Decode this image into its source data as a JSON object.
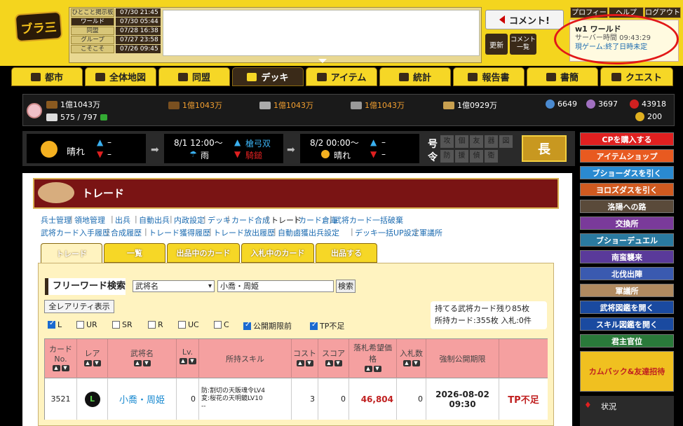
{
  "header": {
    "logo_text": "ブラ三",
    "bbs": {
      "rows": [
        {
          "tab": "ひとこと掲示板",
          "time": "07/30 21:45"
        },
        {
          "tab": "ワールド",
          "time": "07/30 05:44"
        },
        {
          "tab": "同盟",
          "time": "07/28 16:38"
        },
        {
          "tab": "グループ",
          "time": "07/27 23:58"
        },
        {
          "tab": "こそこそ",
          "time": "07/26 09:45"
        }
      ]
    },
    "comment_button": "コメント!",
    "update_button": "更新",
    "list_button": "コメント一覧",
    "links": [
      "プロフィール",
      "ヘルプ",
      "ログアウト"
    ],
    "server": {
      "name": "w1 ワールド",
      "time": "サーバー時間 09:43:29",
      "game": "現ゲーム:終了日時未定"
    }
  },
  "nav": [
    {
      "label": "都市"
    },
    {
      "label": "全体地図"
    },
    {
      "label": "同盟"
    },
    {
      "label": "デッキ"
    },
    {
      "label": "アイテム"
    },
    {
      "label": "統計"
    },
    {
      "label": "報告書"
    },
    {
      "label": "書簡"
    },
    {
      "label": "クエスト"
    }
  ],
  "resources": {
    "wood": "1億1043万",
    "iron": "1億1043万",
    "stone": "1億1043万",
    "grain": "1億1043万",
    "food": "1億0929万",
    "population": "575 / 797",
    "bp": "6649",
    "bp_plus": "3697",
    "tp": "43918",
    "cp": "200"
  },
  "weather": {
    "now_label": "晴れ",
    "now_a": "–",
    "now_b": "–",
    "slot1_time": "8/1 12:00〜",
    "slot1_weather": "雨",
    "slot1_up": "槍弓双",
    "slot1_down": "騎鎚",
    "slot2_time": "8/2 00:00〜",
    "slot2_weather": "晴れ",
    "slot2_up": "–",
    "slot2_down": "–",
    "order_label1": "号",
    "order_label2": "令",
    "orders": [
      "攻",
      "個",
      "友",
      "器",
      "図",
      "防",
      "援",
      "偵",
      "衛"
    ],
    "long_button": "長"
  },
  "sidebar": [
    "CPを購入する",
    "アイテムショップ",
    "ブショーダスを引く",
    "ヨロズダスを引く",
    "洛陽への路",
    "交換所",
    "ブショーデュエル",
    "南蛮襲来",
    "北伐出陣",
    "軍議所",
    "武将図鑑を開く",
    "スキル図鑑を開く",
    "君主官位",
    "カムバック&友達招待",
    "状況"
  ],
  "colors": {
    "accent": "#f6d726",
    "header_bg": "#7a1414",
    "highlight_red": "#e21818"
  },
  "trade": {
    "title": "トレード",
    "links_row1": [
      "兵士管理",
      "領地管理",
      "出兵",
      "自動出兵",
      "内政設定",
      "デッキ",
      "カード合成",
      "トレード",
      "カード倉庫",
      "武将カード一括破棄"
    ],
    "links_row2": [
      "武将カード入手履歴",
      "合成履歴",
      "トレード獲得履歴",
      "トレード放出履歴",
      "自動鹵獲出兵設定",
      "デッキ一括UP設定",
      "軍議所"
    ],
    "tabs": [
      "トレード",
      "一覧",
      "出品中のカード",
      "入札中のカード",
      "出品する"
    ],
    "freeword_label": "フリーワード検索",
    "search_field": "武将名",
    "keyword": "小喬・周姫",
    "search_button": "検索",
    "all_rarity_button": "全レアリティ表示",
    "info_line1": "持てる武将カード残り85枚",
    "info_line2": "所持カード:355枚 入札:0件",
    "filters": [
      {
        "label": "L",
        "checked": true
      },
      {
        "label": "UR",
        "checked": false
      },
      {
        "label": "SR",
        "checked": false
      },
      {
        "label": "R",
        "checked": false
      },
      {
        "label": "UC",
        "checked": false
      },
      {
        "label": "C",
        "checked": false
      },
      {
        "label": "公開期限前",
        "checked": true
      },
      {
        "label": "TP不足",
        "checked": true
      }
    ],
    "table": {
      "headers": [
        "カードNo.",
        "レア",
        "武将名",
        "Lv.",
        "所持スキル",
        "コスト",
        "スコア",
        "落札希望価格",
        "入札数",
        "強制公開期限",
        ""
      ],
      "row": {
        "card_no": "3521",
        "rarity": "L",
        "name": "小喬・周姫",
        "lv": "0",
        "skill1": "防:割切の天販魂令LV4",
        "skill2": "変:桜花の天明鏡LV10",
        "skill3": "--",
        "cost": "3",
        "score": "0",
        "price": "46,804",
        "bids": "0",
        "deadline1": "2026-08-02",
        "deadline2": "09:30",
        "status": "TP不足"
      }
    }
  }
}
